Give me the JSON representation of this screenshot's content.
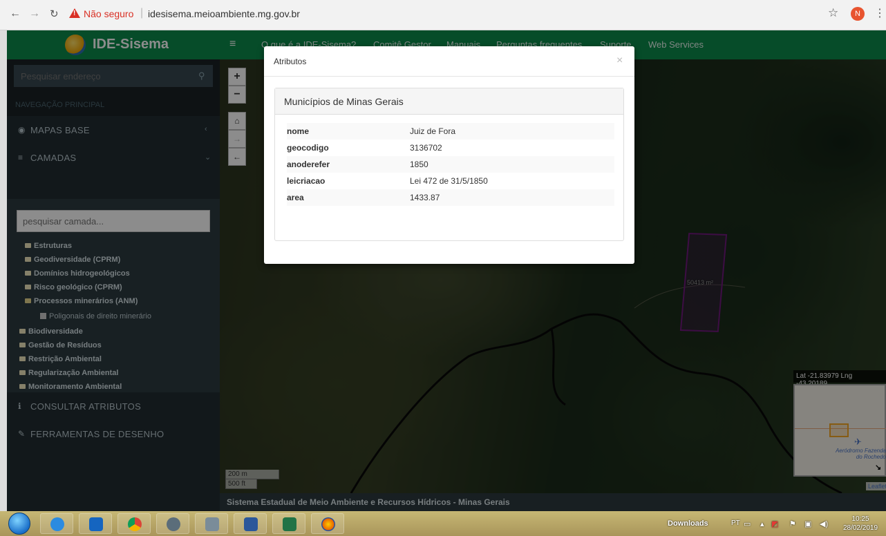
{
  "browser": {
    "security_label": "Não seguro",
    "url": "idesisema.meioambiente.mg.gov.br",
    "profile_initial": "N"
  },
  "app": {
    "logo_text": "IDE-Sisema",
    "nav_links": [
      "O que é a IDE-Sisema?",
      "Comitê Gestor",
      "Manuais",
      "Perguntas frequentes",
      "Suporte",
      "Web Services"
    ],
    "accent_color": "#0c8a4b"
  },
  "sidebar": {
    "search_placeholder": "Pesquisar endereço",
    "section_header": "NAVEGAÇÃO PRINCIPAL",
    "menu": {
      "mapas_base": "MAPAS BASE",
      "camadas": "CAMADAS",
      "consultar": "CONSULTAR ATRIBUTOS",
      "ferramentas": "FERRAMENTAS DE DESENHO"
    },
    "layer_search_placeholder": "pesquisar camada...",
    "tree": [
      "Estruturas",
      "Geodiversidade (CPRM)",
      "Domínios hidrogeológicos",
      "Risco geológico (CPRM)",
      "Processos minerários (ANM)",
      "Poligonais de direito minerário",
      "Biodiversidade",
      "Gestão de Resíduos",
      "Restrição Ambiental",
      "Regularização Ambiental",
      "Monitoramento Ambiental"
    ]
  },
  "map": {
    "zoom_in": "+",
    "zoom_out": "−",
    "scale_m": "200 m",
    "scale_ft": "500 ft",
    "coord_readout": "Lat -21.83979 Lng -43.20189",
    "minimap_label": "Aeródromo Fazenda do Rochedo",
    "attribution": "Leaflet",
    "parcel_area": "50413 m²",
    "parcel_color": "#c02bd6"
  },
  "footer": {
    "text": "Sistema Estadual de Meio Ambiente e Recursos Hídricos - Minas Gerais"
  },
  "modal": {
    "title": "Atributos",
    "close": "×",
    "panel_title": "Municípios de Minas Gerais",
    "rows": [
      {
        "key": "nome",
        "value": "Juiz de Fora"
      },
      {
        "key": "geocodigo",
        "value": "3136702"
      },
      {
        "key": "anoderefer",
        "value": "1850"
      },
      {
        "key": "leicriacao",
        "value": "Lei 472 de 31/5/1850"
      },
      {
        "key": "area",
        "value": "1433.87"
      }
    ]
  },
  "taskbar": {
    "downloads": "Downloads",
    "lang": "PT",
    "time": "10:25",
    "date": "28/02/2019"
  }
}
